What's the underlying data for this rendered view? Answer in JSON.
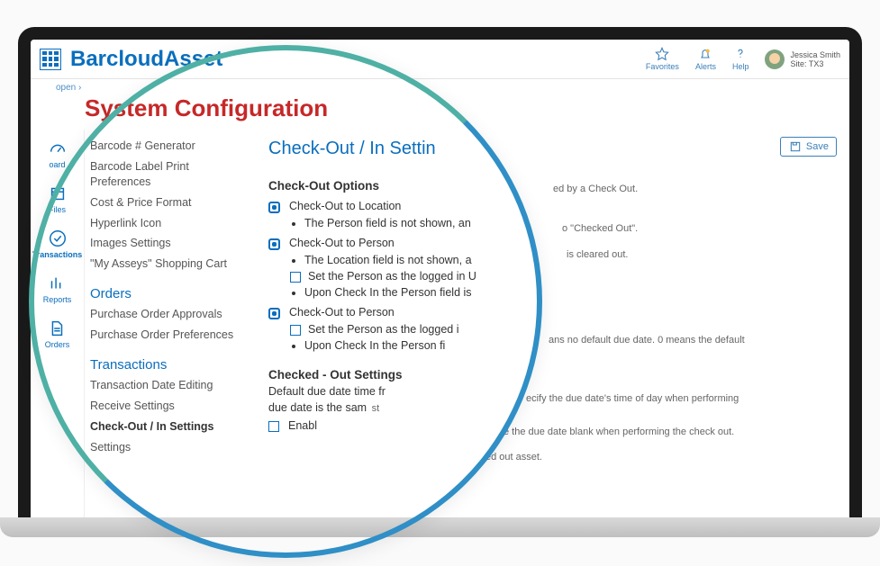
{
  "brand": "BarcloudAsset",
  "breadcrumb": "open ›",
  "page_title": "System Configuration",
  "topnav": {
    "favorites": "Favorites",
    "alerts": "Alerts",
    "help": "Help",
    "user_name": "Jessica Smith",
    "user_site": "Site: TX3"
  },
  "leftnav": {
    "dashboard": "oard",
    "files": "Files",
    "transactions": "Transactions",
    "reports": "Reports",
    "orders": "Orders"
  },
  "sidebar": {
    "items1": [
      "Barcode # Generator",
      "Barcode Label Print Preferences",
      "Cost & Price Format",
      "Hyperlink Icon",
      "Images Settings",
      "\"My Asseys\" Shopping Cart"
    ],
    "orders_hdr": "Orders",
    "orders_items": [
      "Purchase Order Approvals",
      "Purchase Order Preferences"
    ],
    "trans_hdr": "Transactions",
    "trans_items": [
      "Transaction Date Editing",
      "Receive Settings",
      "Check-Out / In Settings",
      "Settings"
    ]
  },
  "main": {
    "title": "Check-Out / In Settin",
    "save": "Save",
    "section1": "Check-Out Options",
    "opt1": "Check-Out to Location",
    "opt1_b1": "The Person field is not shown, an",
    "opt2": "Check-Out to Person",
    "opt2_b1": "The Location field is not shown, a",
    "opt2_c1": "Set the Person as the logged in U",
    "opt2_b2": "Upon Check In the Person field is",
    "opt3": "Check-Out to Person",
    "opt3_c1": "Set the Person as the logged i",
    "opt3_b1": "Upon Check In the Person fi",
    "section2": "Checked - Out Settings",
    "line1": "Default due date time fr",
    "line2": "due date is the sam",
    "line3": "Enabl",
    "faded1": "ed by a Check Out.",
    "faded2": "o \"Checked Out\".",
    "faded3": "is cleared out.",
    "faded4": "ans no default due date. 0 means the default",
    "faded5": "ecify the due date's time of day when performing",
    "faded6": "e the due date blank when performing the check out.",
    "faded7": "ed out asset.",
    "faded8": "st"
  }
}
